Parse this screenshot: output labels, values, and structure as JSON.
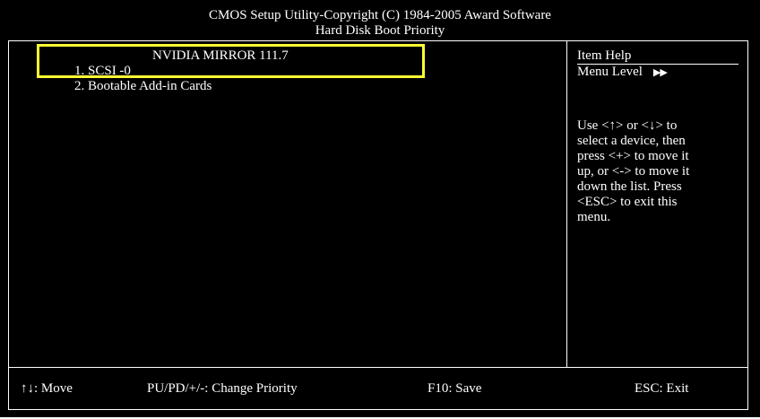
{
  "header": {
    "line1": "CMOS Setup Utility-Copyright (C) 1984-2005 Award Software",
    "line2": "Hard Disk Boot Priority"
  },
  "boot_list": {
    "items": [
      {
        "label": "1. SCSI -0",
        "device": "NVIDIA MIRROR 111.7"
      },
      {
        "label": "2. Bootable Add-in Cards",
        "device": ""
      }
    ],
    "highlight_color": "#ffff33"
  },
  "item_help": {
    "title": "Item Help",
    "menu_level_label": "Menu Level",
    "menu_level_arrows": "▶▶",
    "text": "Use <↑> or <↓> to\nselect a device, then\npress <+> to move it\nup, or <-> to move it\ndown the list. Press\n<ESC> to exit this\nmenu."
  },
  "footer": {
    "move": "↑↓: Move",
    "change_priority": "PU/PD/+/-: Change Priority",
    "save": "F10: Save",
    "exit": "ESC: Exit"
  },
  "colors": {
    "background": "#000000",
    "text": "#ffffff",
    "highlight": "#ffff33"
  }
}
